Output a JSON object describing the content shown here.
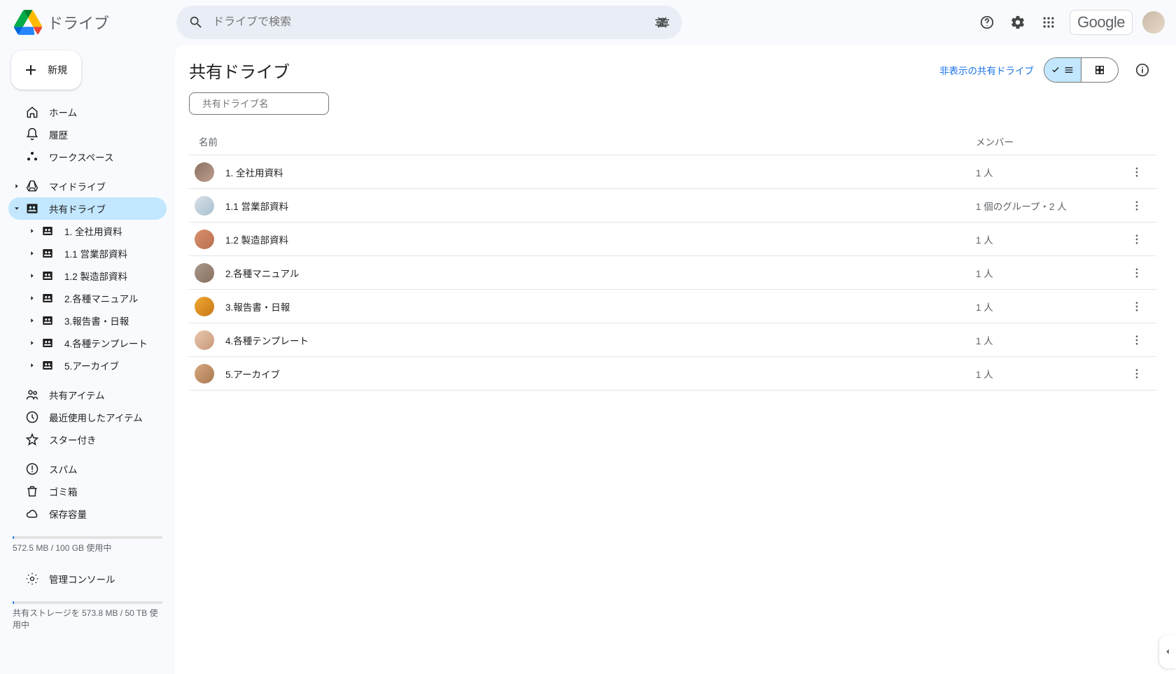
{
  "app": {
    "name": "ドライブ",
    "google_text": "Google"
  },
  "search": {
    "placeholder": "ドライブで検索"
  },
  "newBtn": {
    "label": "新規"
  },
  "nav": {
    "home": "ホーム",
    "activity": "履歴",
    "workspaces": "ワークスペース",
    "mydrive": "マイドライブ",
    "shareddrives": "共有ドライブ",
    "sharedItems": "共有アイテム",
    "recent": "最近使用したアイテム",
    "starred": "スター付き",
    "spam": "スパム",
    "trash": "ゴミ箱",
    "storage": "保存容量",
    "admin": "管理コンソール"
  },
  "sdSub": [
    "1. 全社用資料",
    "1.1 営業部資料",
    "1.2 製造部資料",
    "2.各種マニュアル",
    "3.報告書・日報",
    "4.各種テンプレート",
    "5.アーカイブ"
  ],
  "storage": {
    "text": "572.5 MB / 100 GB 使用中",
    "sharedText": "共有ストレージを 573.8 MB / 50 TB 使用中"
  },
  "main": {
    "title": "共有ドライブ",
    "hiddenLink": "非表示の共有ドライブ",
    "filterPlaceholder": "共有ドライブ名",
    "colName": "名前",
    "colMembers": "メンバー"
  },
  "rows": [
    {
      "name": "1. 全社用資料",
      "members": "1 人",
      "color": "linear-gradient(135deg,#8a7060,#bfa090)"
    },
    {
      "name": "1.1 営業部資料",
      "members": "1 個のグループ・2 人",
      "color": "linear-gradient(135deg,#d8e0e8,#a8c0d0)"
    },
    {
      "name": "1.2 製造部資料",
      "members": "1 人",
      "color": "linear-gradient(135deg,#d8906c,#b87050)"
    },
    {
      "name": "2.各種マニュアル",
      "members": "1 人",
      "color": "linear-gradient(135deg,#a8988a,#887060)"
    },
    {
      "name": "3.報告書・日報",
      "members": "1 人",
      "color": "linear-gradient(135deg,#f0a830,#c87818)"
    },
    {
      "name": "4.各種テンプレート",
      "members": "1 人",
      "color": "linear-gradient(135deg,#e8c8b0,#c89878)"
    },
    {
      "name": "5.アーカイブ",
      "members": "1 人",
      "color": "linear-gradient(135deg,#d8a880,#a87850)"
    }
  ]
}
